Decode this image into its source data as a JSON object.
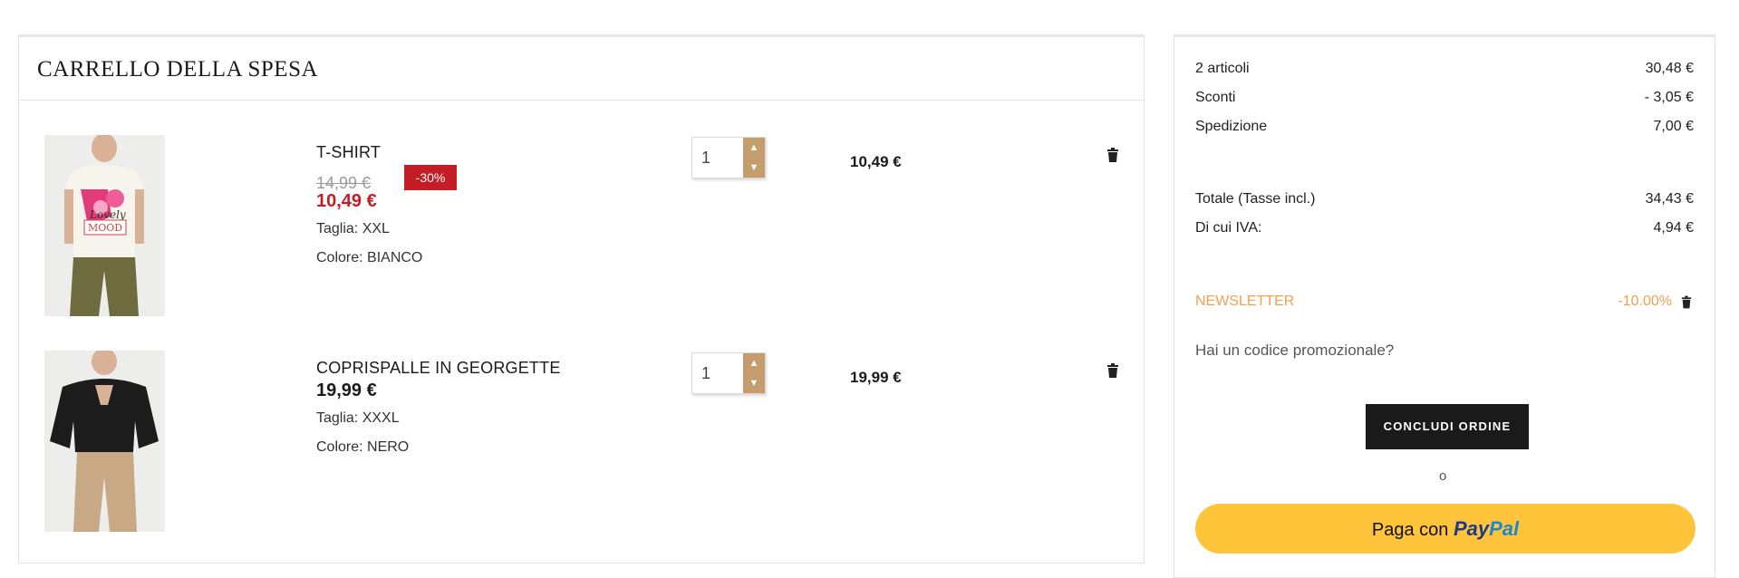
{
  "cart": {
    "title": "CARRELLO DELLA SPESA",
    "items": [
      {
        "name": "T-SHIRT",
        "old_price": "14,99 €",
        "discount": "-30%",
        "price": "10,49 €",
        "size": "Taglia: XXL",
        "color": "Colore: BIANCO",
        "quantity": "1",
        "line_total": "10,49 €",
        "image_text_1": "Lovely",
        "image_text_2": "MOOD"
      },
      {
        "name": "COPRISPALLE IN GEORGETTE",
        "price": "19,99 €",
        "size": "Taglia: XXXL",
        "color": "Colore: NERO",
        "quantity": "1",
        "line_total": "19,99 €"
      }
    ]
  },
  "summary": {
    "articles_label": "2 articoli",
    "articles_value": "30,48 €",
    "discounts_label": "Sconti",
    "discounts_value": "- 3,05 €",
    "shipping_label": "Spedizione",
    "shipping_value": "7,00 €",
    "total_label": "Totale (Tasse incl.)",
    "total_value": "34,43 €",
    "vat_label": "Di cui IVA:",
    "vat_value": "4,94 €",
    "newsletter_label": "NEWSLETTER",
    "newsletter_value": "-10.00%",
    "promo_label": "Hai un codice promozionale?",
    "checkout_label": "CONCLUDI ORDINE",
    "or_label": "o",
    "paypal_prefix": "Paga con",
    "paypal_brand_1": "Pay",
    "paypal_brand_2": "Pal"
  },
  "colors": {
    "sale_red": "#c41d26",
    "qty_accent": "#c59c6b",
    "newsletter_orange": "#f0a050",
    "checkout_black": "#1a1a1a",
    "paypal_yellow": "#ffc43a"
  },
  "icons": {
    "trash": "trash-icon",
    "qty_up": "chevron-up-icon",
    "qty_down": "chevron-down-icon"
  }
}
